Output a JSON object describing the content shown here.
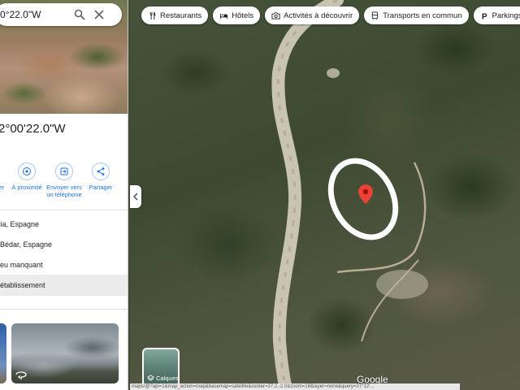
{
  "search": {
    "value": "0°22.0\"W"
  },
  "place": {
    "coords_title": "2°00'22.0\"W"
  },
  "actions": [
    {
      "label": "er",
      "icon": "directions-icon"
    },
    {
      "label": "À proximité",
      "icon": "nearby-icon"
    },
    {
      "label": "Envoyer vers un téléphone",
      "icon": "send-to-phone-icon"
    },
    {
      "label": "Partager",
      "icon": "share-icon"
    }
  ],
  "details": [
    {
      "text": "ía, Espagne"
    },
    {
      "text": "Bédar, Espagne"
    },
    {
      "text": "eu manquant"
    },
    {
      "text": "établissement"
    }
  ],
  "map": {
    "chips": [
      {
        "label": "Restaurants",
        "icon": "fork-knife-icon"
      },
      {
        "label": "Hôtels",
        "icon": "bed-icon"
      },
      {
        "label": "Activités à découvrir",
        "icon": "camera-icon"
      },
      {
        "label": "Transports en commun",
        "icon": "bus-icon"
      },
      {
        "label": "Parkings",
        "icon": "parking-icon"
      }
    ],
    "more_chip": ">",
    "layers_label": "Calques",
    "logo": "Google",
    "statusbar_url": "maps/@?api=1&map_action=map&basemap=satellite&center=37.2,-2.0&zoom=18&layer=none&query=37°12'..."
  },
  "colors": {
    "accent": "#1a73e8",
    "pin": "#ea4335"
  }
}
